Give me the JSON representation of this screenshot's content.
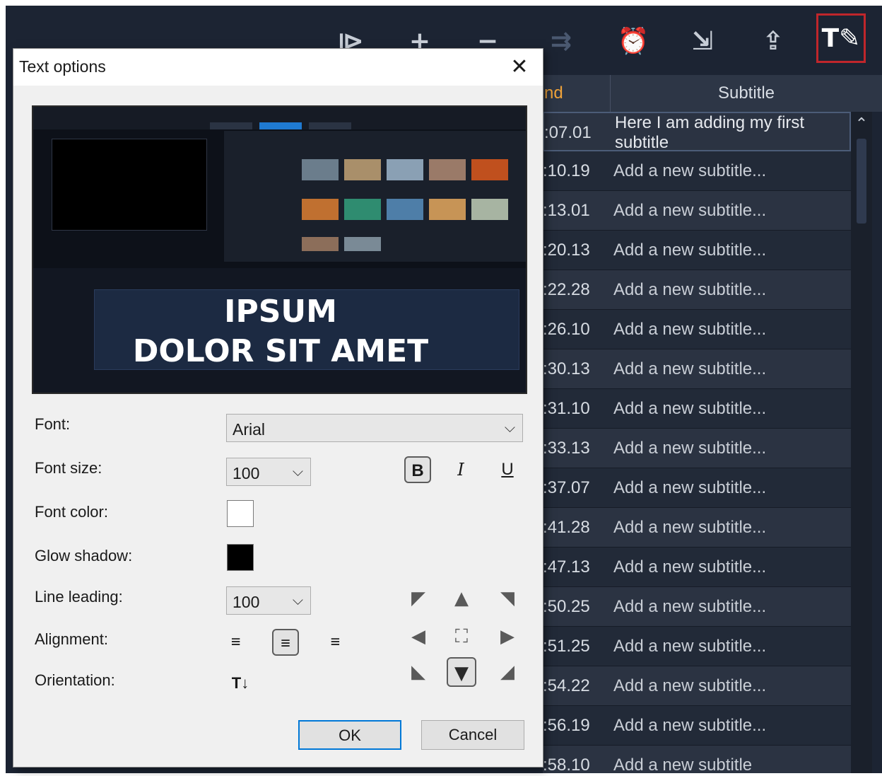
{
  "toolbar": {
    "buttons": [
      {
        "name": "play-subtitle-icon",
        "glyph": "⧐"
      },
      {
        "name": "add-subtitle-icon",
        "glyph": "+"
      },
      {
        "name": "remove-subtitle-icon",
        "glyph": "−"
      },
      {
        "name": "merge-subtitle-icon",
        "glyph": "⇉"
      },
      {
        "name": "timecode-offset-icon",
        "glyph": "⏰"
      },
      {
        "name": "import-subtitle-icon",
        "glyph": "⇲"
      },
      {
        "name": "export-subtitle-icon",
        "glyph": "⇪"
      },
      {
        "name": "text-options-icon",
        "glyph": "T✎"
      }
    ]
  },
  "grid": {
    "end_header": "nd",
    "subtitle_header": "Subtitle",
    "rows": [
      {
        "end": ":07.01",
        "subtitle": "Here I am adding my first subtitle"
      },
      {
        "end": ":10.19",
        "subtitle": "Add a new subtitle..."
      },
      {
        "end": ":13.01",
        "subtitle": "Add a new subtitle..."
      },
      {
        "end": ":20.13",
        "subtitle": "Add a new subtitle..."
      },
      {
        "end": ":22.28",
        "subtitle": "Add a new subtitle..."
      },
      {
        "end": ":26.10",
        "subtitle": "Add a new subtitle..."
      },
      {
        "end": ":30.13",
        "subtitle": "Add a new subtitle..."
      },
      {
        "end": ":31.10",
        "subtitle": "Add a new subtitle..."
      },
      {
        "end": ":33.13",
        "subtitle": "Add a new subtitle..."
      },
      {
        "end": ":37.07",
        "subtitle": "Add a new subtitle..."
      },
      {
        "end": ":41.28",
        "subtitle": "Add a new subtitle..."
      },
      {
        "end": ":47.13",
        "subtitle": "Add a new subtitle..."
      },
      {
        "end": ":50.25",
        "subtitle": "Add a new subtitle..."
      },
      {
        "end": ":51.25",
        "subtitle": "Add a new subtitle..."
      },
      {
        "end": ":54.22",
        "subtitle": "Add a new subtitle..."
      },
      {
        "end": ":56.19",
        "subtitle": "Add a new subtitle..."
      },
      {
        "end": ":58.10",
        "subtitle": "Add a new subtitle"
      }
    ]
  },
  "dialog": {
    "title": "Text options",
    "close_glyph": "✕",
    "preview_text": [
      "IPSUM",
      "DOLOR SIT AMET"
    ],
    "font_label": "Font:",
    "font_value": "Arial",
    "font_size_label": "Font size:",
    "font_size_value": "100",
    "bold": "B",
    "italic": "I",
    "underline": "U",
    "font_color_label": "Font color:",
    "font_color": "#ffffff",
    "glow_shadow_label": "Glow shadow:",
    "glow_shadow_color": "#000000",
    "line_leading_label": "Line leading:",
    "line_leading_value": "100",
    "alignment_label": "Alignment:",
    "orientation_label": "Orientation:",
    "orientation_glyph": "T↓",
    "align_glyphs": [
      "≡",
      "≡",
      "≡"
    ],
    "position_glyphs": [
      "◤",
      "▲",
      "◥",
      "◀",
      "⛶",
      "▶",
      "◣",
      "▼",
      "◢"
    ],
    "ok_label": "OK",
    "cancel_label": "Cancel",
    "chevron": "⌵"
  },
  "scroll_up_glyph": "⌃"
}
